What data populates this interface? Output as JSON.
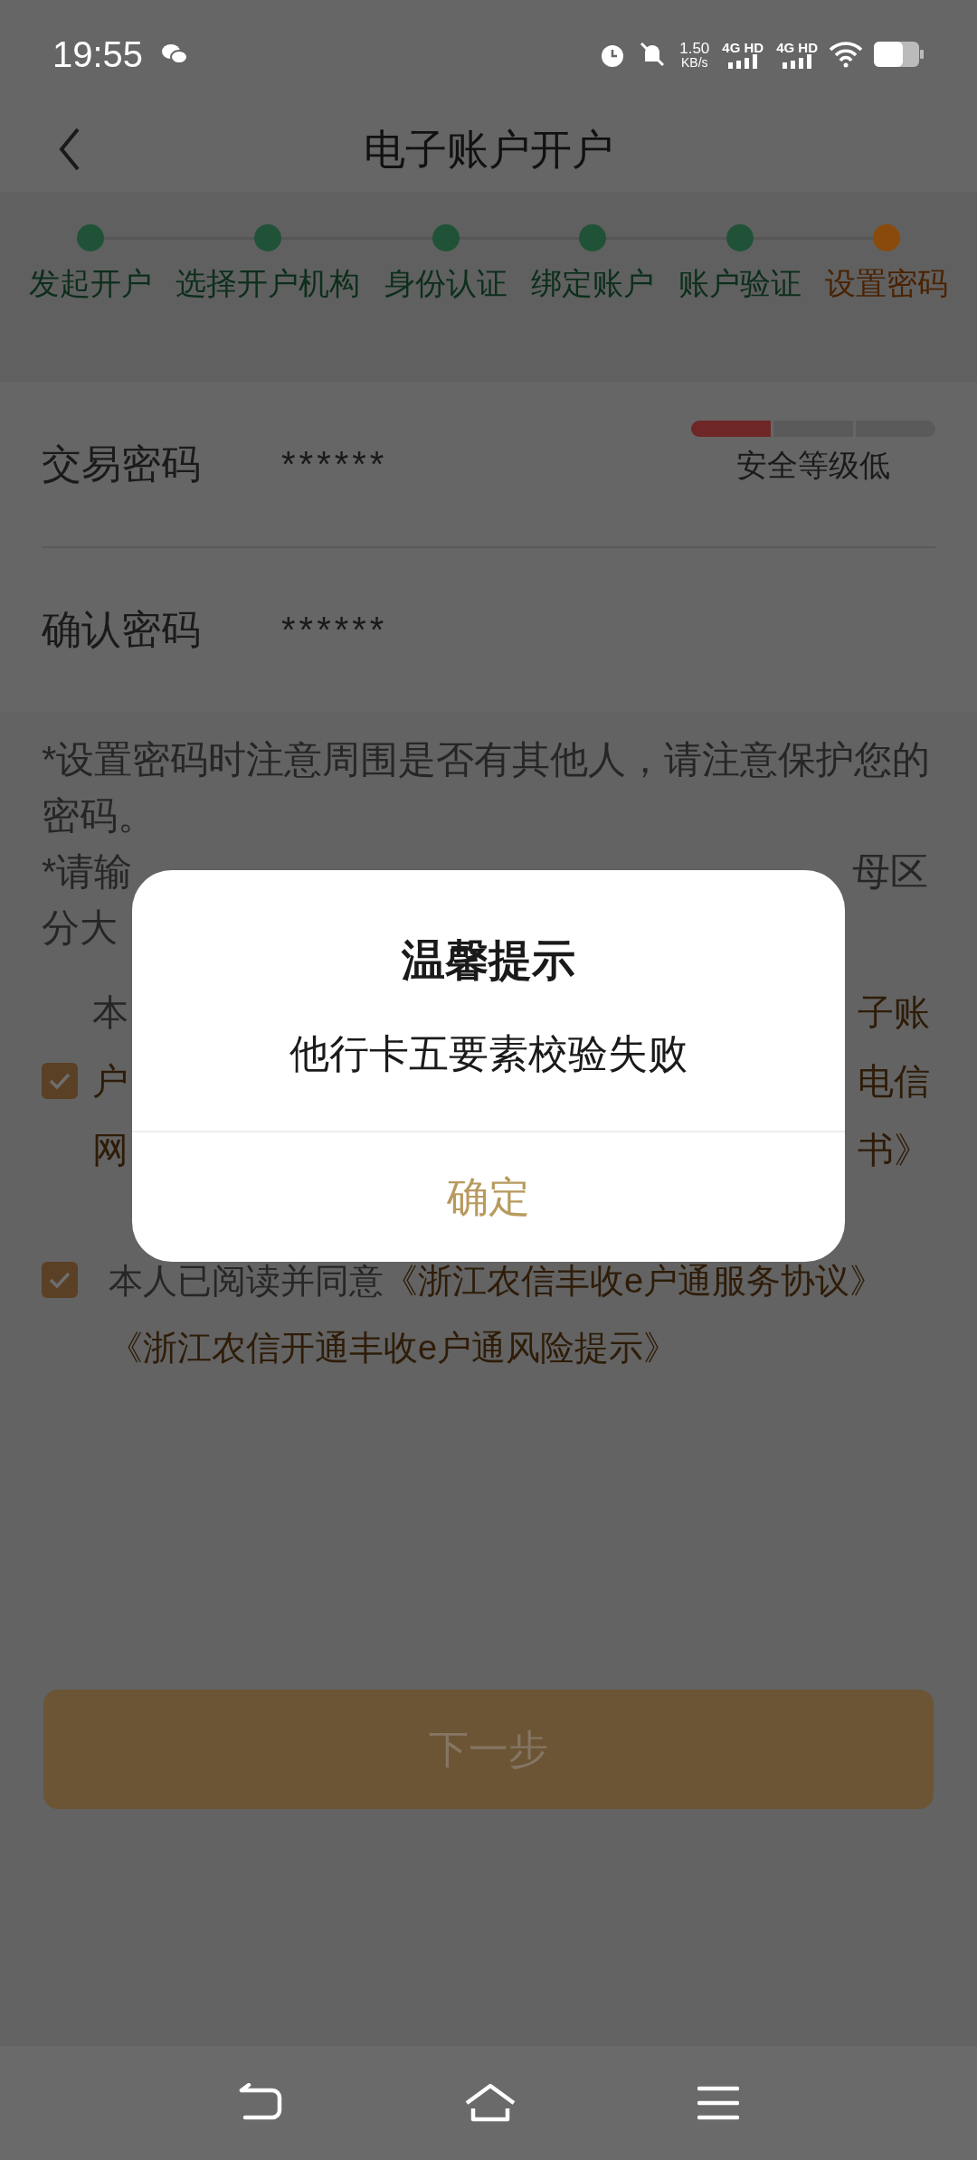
{
  "status_bar": {
    "time": "19:55",
    "net_speed_value": "1.50",
    "net_speed_unit": "KB/s",
    "sim_1": "4G HD",
    "sim_2": "4G HD"
  },
  "header": {
    "title": "电子账户开户"
  },
  "steps": [
    {
      "label": "发起开户",
      "selected": false
    },
    {
      "label": "选择开户机构",
      "selected": false
    },
    {
      "label": "身份认证",
      "selected": false
    },
    {
      "label": "绑定账户",
      "selected": false
    },
    {
      "label": "账户验证",
      "selected": false
    },
    {
      "label": "设置密码",
      "selected": true
    }
  ],
  "form": {
    "fields": [
      {
        "label": "交易密码",
        "value": "******",
        "strength": {
          "level": 0.33,
          "label": "安全等级低"
        }
      },
      {
        "label": "确认密码",
        "value": "******"
      }
    ]
  },
  "notes": {
    "note_1": "*设置密码时注意周围是否有其他人，请注意保护您的密码。",
    "covered_lines": [
      {
        "left": "*请输",
        "right": "母区"
      },
      {
        "left": "分大"
      }
    ]
  },
  "agreement_1": {
    "checked": true,
    "lines": [
      {
        "left": {
          "text": "本",
          "link": false
        },
        "right": {
          "text": "子账",
          "link": true
        }
      },
      {
        "left": {
          "text": "户",
          "link": true
        },
        "right": {
          "text": "电信",
          "link": true
        }
      },
      {
        "left": {
          "text": "网",
          "link": true
        },
        "right": {
          "text": "书》",
          "link": true
        }
      }
    ]
  },
  "agreement_2": {
    "checked": true,
    "parts": [
      {
        "text": "本人已阅读并同意",
        "link": false
      },
      {
        "text": "《浙江农信丰收e户通服务协议》",
        "link": true
      },
      {
        "text": "《浙江农信开通丰收e户通风险提示》",
        "link": true
      }
    ]
  },
  "next_button": {
    "label": "下一步"
  },
  "dialog": {
    "title": "温馨提示",
    "message": "他行卡五要素校验失败",
    "confirm": "确定"
  }
}
